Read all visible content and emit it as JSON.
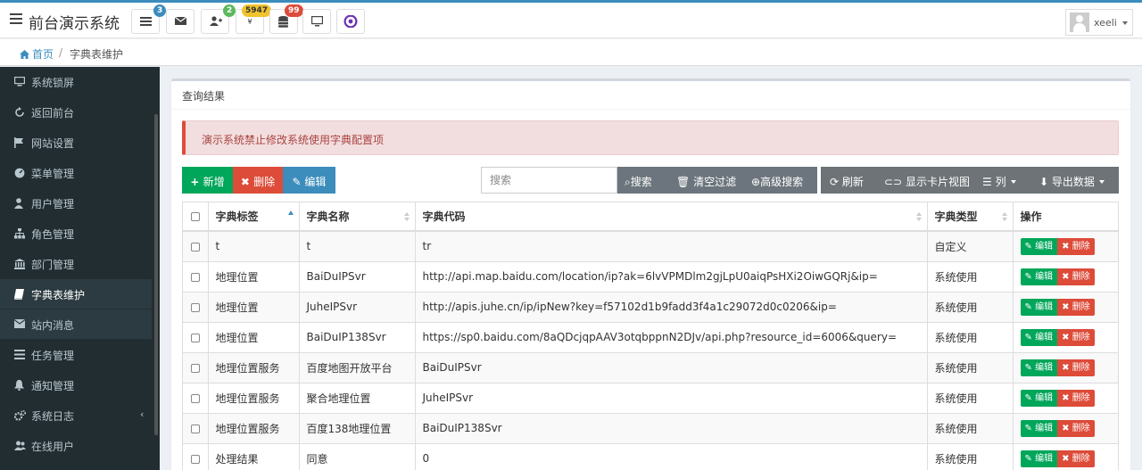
{
  "header": {
    "app_title": "前台演示系统",
    "notif": [
      {
        "icon": "tasks-icon",
        "badge": "3",
        "badge_color": "#3c8dbc"
      },
      {
        "icon": "envelope-icon",
        "badge": "",
        "badge_color": ""
      },
      {
        "icon": "user-add-icon",
        "badge": "2",
        "badge_color": "#5cb85c"
      },
      {
        "icon": "coin-icon",
        "text": "¥",
        "badge": "5947",
        "badge_color": "#f0c32d"
      },
      {
        "icon": "database-icon",
        "badge": "99",
        "badge_color": "#dd4b39"
      },
      {
        "icon": "monitor-icon",
        "badge": "",
        "badge_color": ""
      },
      {
        "icon": "app-logo-icon",
        "badge": "",
        "badge_color": ""
      }
    ],
    "user_name": "xeeli"
  },
  "breadcrumb": {
    "home": "首页",
    "separator": "/",
    "current": "字典表维护"
  },
  "sidebar": {
    "items": [
      {
        "label": "系统锁屏",
        "icon": "monitor-icon"
      },
      {
        "label": "返回前台",
        "icon": "refresh-icon"
      },
      {
        "label": "网站设置",
        "icon": "flag-icon"
      },
      {
        "label": "菜单管理",
        "icon": "dashboard-icon"
      },
      {
        "label": "用户管理",
        "icon": "user-icon"
      },
      {
        "label": "角色管理",
        "icon": "sitemap-icon"
      },
      {
        "label": "部门管理",
        "icon": "bank-icon"
      },
      {
        "label": "字典表维护",
        "icon": "book-icon",
        "active": true
      },
      {
        "label": "站内消息",
        "icon": "envelope-icon"
      },
      {
        "label": "任务管理",
        "icon": "tasks-icon"
      },
      {
        "label": "通知管理",
        "icon": "bell-icon"
      },
      {
        "label": "系统日志",
        "icon": "gears-icon",
        "chevron": "‹"
      },
      {
        "label": "在线用户",
        "icon": "users-icon"
      }
    ]
  },
  "panel": {
    "title": "查询结果",
    "alert": "演示系统禁止修改系统使用字典配置项"
  },
  "toolbar": {
    "add": "新增",
    "delete": "删除",
    "edit": "编辑",
    "search_placeholder": "搜索",
    "search": "搜索",
    "clear_filter": "清空过滤",
    "advanced_search": "高级搜索",
    "refresh": "刷新",
    "card_view": "显示卡片视图",
    "columns": "列",
    "export": "导出数据"
  },
  "table": {
    "headers": [
      "字典标签",
      "字典名称",
      "字典代码",
      "字典类型",
      "操作"
    ],
    "edit_label": "编辑",
    "delete_label": "删除",
    "rows": [
      [
        "t",
        "t",
        "tr",
        "自定义"
      ],
      [
        "地理位置",
        "BaiDuIPSvr",
        "http://api.map.baidu.com/location/ip?ak=6lvVPMDlm2gjLpU0aiqPsHXi2OiwGQRj&ip=",
        "系统使用"
      ],
      [
        "地理位置",
        "JuheIPSvr",
        "http://apis.juhe.cn/ip/ipNew?key=f57102d1b9fadd3f4a1c29072d0c0206&ip=",
        "系统使用"
      ],
      [
        "地理位置",
        "BaiDuIP138Svr",
        "https://sp0.baidu.com/8aQDcjqpAAV3otqbppnN2DJv/api.php?resource_id=6006&query=",
        "系统使用"
      ],
      [
        "地理位置服务",
        "百度地图开放平台",
        "BaiDuIPSvr",
        "系统使用"
      ],
      [
        "地理位置服务",
        "聚合地理位置",
        "JuheIPSvr",
        "系统使用"
      ],
      [
        "地理位置服务",
        "百度138地理位置",
        "BaiDuIP138Svr",
        "系统使用"
      ],
      [
        "处理结果",
        "同意",
        "0",
        "系统使用"
      ]
    ]
  },
  "colors": {
    "accent": "#3c8dbc",
    "sidebar_bg": "#222d32",
    "success": "#00a65a",
    "danger": "#dd4b39"
  }
}
